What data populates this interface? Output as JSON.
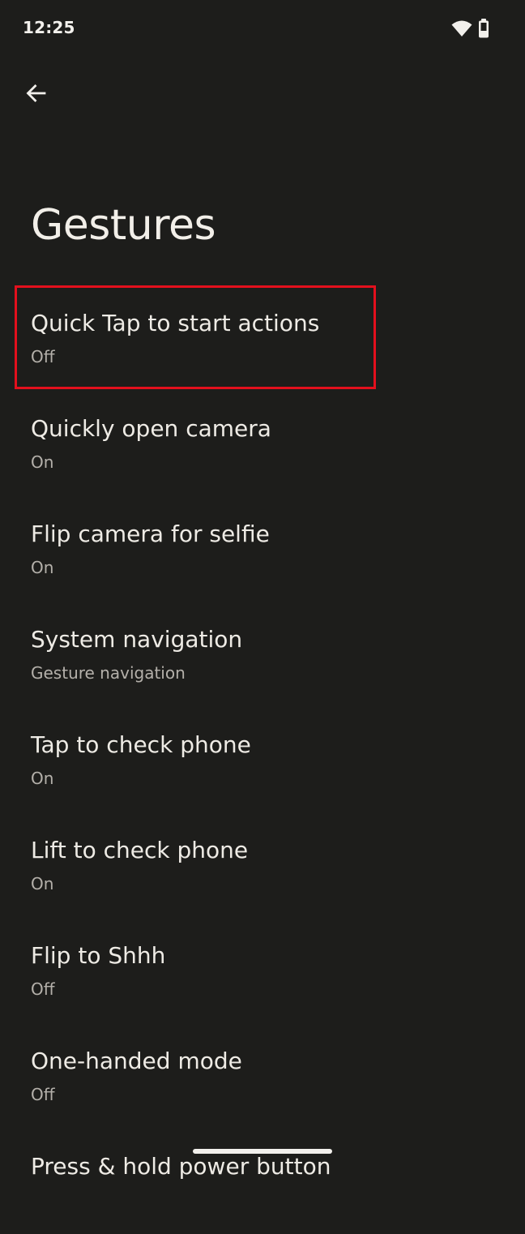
{
  "status_bar": {
    "time": "12:25",
    "wifi_icon": "wifi-icon",
    "battery_icon": "battery-icon"
  },
  "toolbar": {
    "back_icon": "arrow-back-icon"
  },
  "page": {
    "title": "Gestures"
  },
  "settings": [
    {
      "title": "Quick Tap to start actions",
      "summary": "Off"
    },
    {
      "title": "Quickly open camera",
      "summary": "On"
    },
    {
      "title": "Flip camera for selfie",
      "summary": "On"
    },
    {
      "title": "System navigation",
      "summary": "Gesture navigation"
    },
    {
      "title": "Tap to check phone",
      "summary": "On"
    },
    {
      "title": "Lift to check phone",
      "summary": "On"
    },
    {
      "title": "Flip to Shhh",
      "summary": "Off"
    },
    {
      "title": "One-handed mode",
      "summary": "Off"
    },
    {
      "title": "Press & hold power button",
      "summary": ""
    }
  ],
  "colors": {
    "background": "#1d1d1b",
    "highlight": "#e3101d"
  }
}
